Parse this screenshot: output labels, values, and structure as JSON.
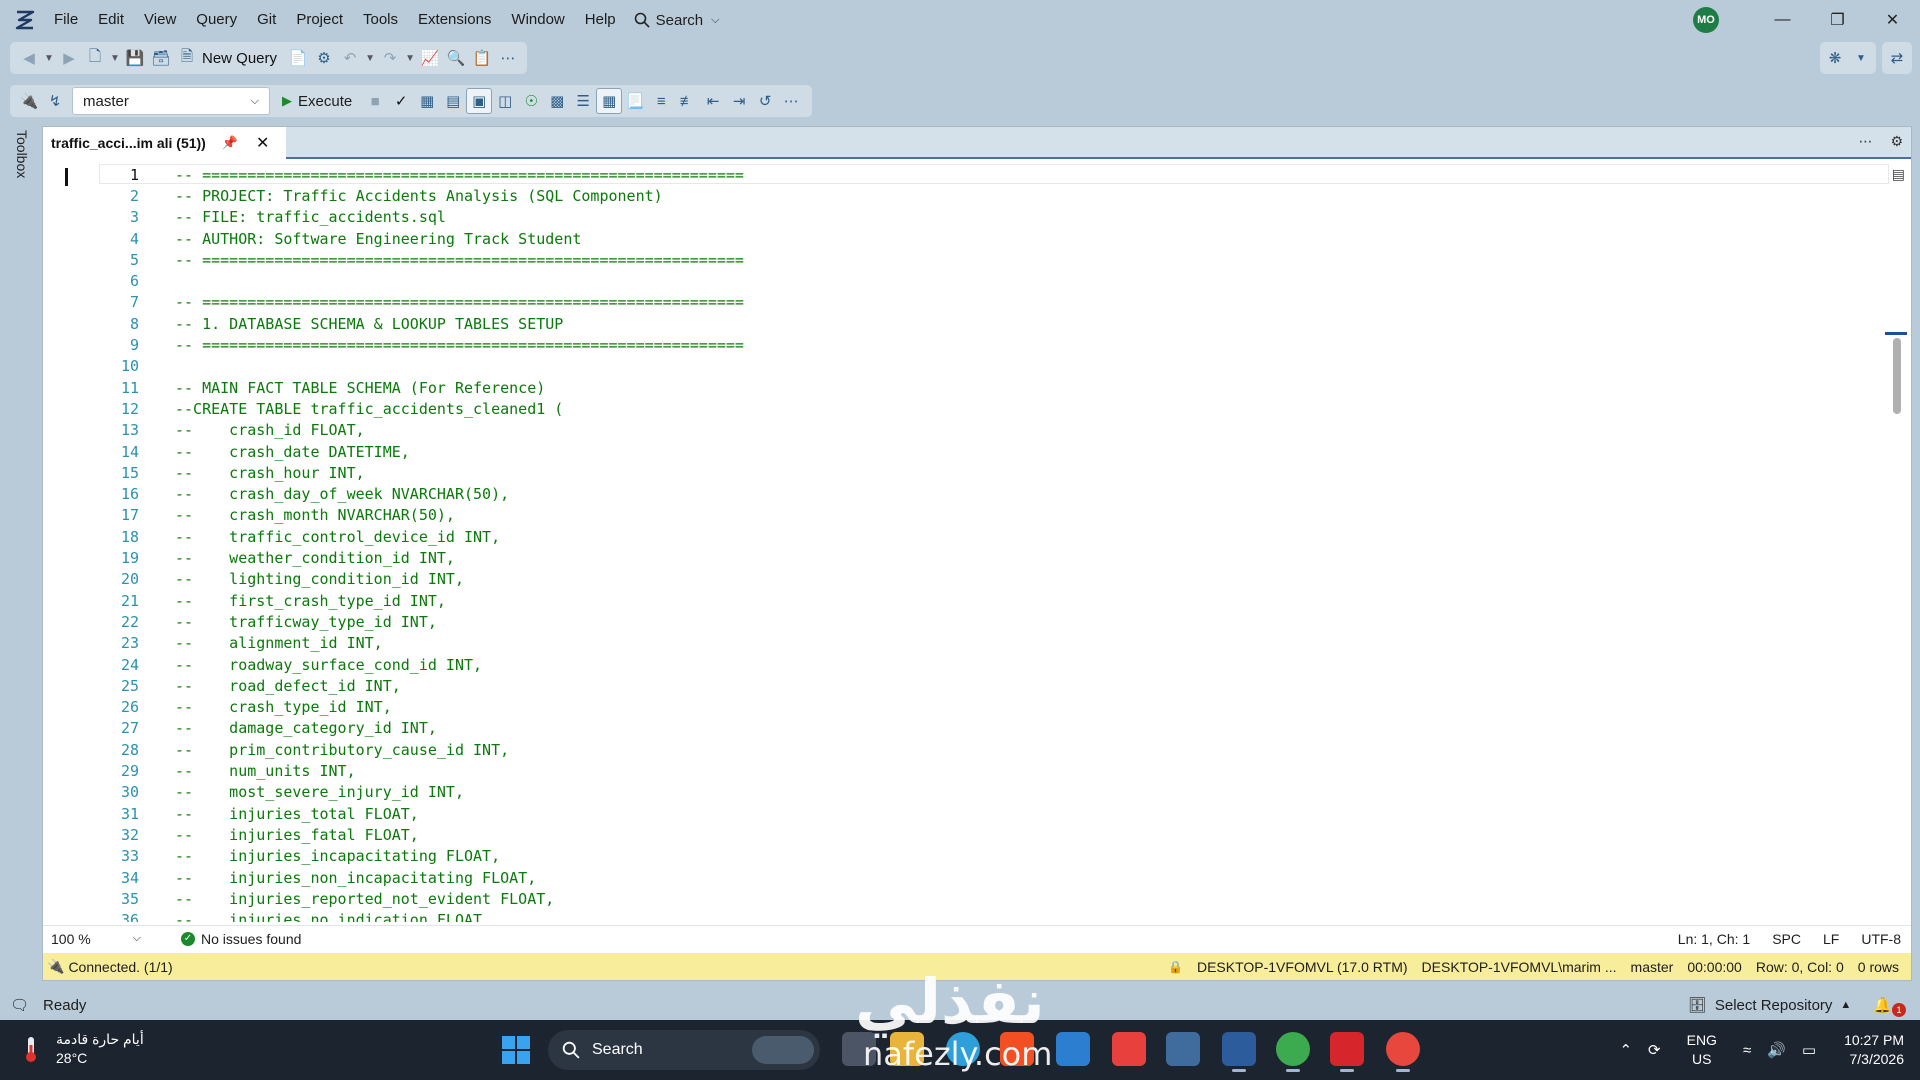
{
  "menu": [
    "File",
    "Edit",
    "View",
    "Query",
    "Git",
    "Project",
    "Tools",
    "Extensions",
    "Window",
    "Help"
  ],
  "search_label": "Search",
  "user_initials": "MO",
  "toolbar": {
    "new_query": "New Query",
    "database": "master",
    "execute": "Execute"
  },
  "toolbox_label": "Toolbox",
  "tab": {
    "title": "traffic_acci...im ali (51))"
  },
  "code_lines": [
    "-- ============================================================",
    "-- PROJECT: Traffic Accidents Analysis (SQL Component)",
    "-- FILE: traffic_accidents.sql",
    "-- AUTHOR: Software Engineering Track Student",
    "-- ============================================================",
    "",
    "-- ============================================================",
    "-- 1. DATABASE SCHEMA & LOOKUP TABLES SETUP",
    "-- ============================================================",
    "",
    "-- MAIN FACT TABLE SCHEMA (For Reference)",
    "--CREATE TABLE traffic_accidents_cleaned1 (",
    "--    crash_id FLOAT,",
    "--    crash_date DATETIME,",
    "--    crash_hour INT,",
    "--    crash_day_of_week NVARCHAR(50),",
    "--    crash_month NVARCHAR(50),",
    "--    traffic_control_device_id INT,",
    "--    weather_condition_id INT,",
    "--    lighting_condition_id INT,",
    "--    first_crash_type_id INT,",
    "--    trafficway_type_id INT,",
    "--    alignment_id INT,",
    "--    roadway_surface_cond_id INT,",
    "--    road_defect_id INT,",
    "--    crash_type_id INT,",
    "--    damage_category_id INT,",
    "--    prim_contributory_cause_id INT,",
    "--    num_units INT,",
    "--    most_severe_injury_id INT,",
    "--    injuries_total FLOAT,",
    "--    injuries_fatal FLOAT,",
    "--    injuries_incapacitating FLOAT,",
    "--    injuries_non_incapacitating FLOAT,",
    "--    injuries_reported_not_evident FLOAT,",
    "--    injuries_no_indication FLOAT"
  ],
  "infobar": {
    "zoom": "100 %",
    "issues": "No issues found",
    "position": "Ln: 1, Ch: 1",
    "indent": "SPC",
    "eol": "LF",
    "encoding": "UTF-8"
  },
  "connection": {
    "status": "Connected. (1/1)",
    "server": "DESKTOP-1VFOMVL (17.0 RTM)",
    "user": "DESKTOP-1VFOMVL\\marim ...",
    "database": "master",
    "elapsed": "00:00:00",
    "cursor": "Row: 0, Col: 0",
    "rows": "0 rows"
  },
  "status": {
    "ready": "Ready",
    "repo": "Select Repository",
    "notifications": "1"
  },
  "taskbar": {
    "weather_text": "أيام حارة قادمة",
    "temperature": "28°C",
    "search": "Search",
    "lang": "ENG",
    "region": "US",
    "time": "10:27 PM",
    "date": "7/3/2026"
  },
  "watermark": {
    "arabic": "نفذلي",
    "latin": "nafezly.com"
  },
  "colors": {
    "accent": "#4a6fa0",
    "comment": "#0a7a0a",
    "line_number": "#2b91af",
    "connection_bar": "#f7ed9b"
  }
}
